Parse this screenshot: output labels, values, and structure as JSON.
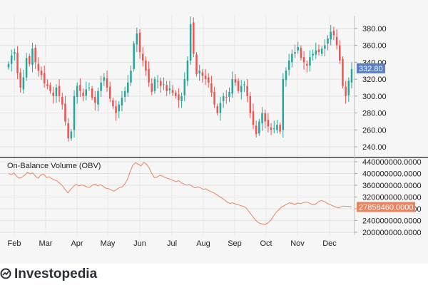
{
  "chart_data": [
    {
      "type": "candlestick",
      "title": "",
      "ylim": [
        230,
        395
      ],
      "y_ticks": [
        "380.00",
        "360.00",
        "340.00",
        "320.00",
        "300.00",
        "280.00",
        "260.00",
        "240.00"
      ],
      "current_value_label": "332.80",
      "colors": {
        "up": "#26a69a",
        "down": "#ef5350",
        "badge": "#5b7fc7"
      },
      "x_months": [
        "Feb",
        "Mar",
        "Apr",
        "May",
        "Jun",
        "Jul",
        "Aug",
        "Sep",
        "Oct",
        "Nov",
        "Dec"
      ],
      "close_path": [
        338,
        348,
        352,
        327,
        310,
        322,
        345,
        338,
        356,
        340,
        330,
        325,
        315,
        312,
        306,
        300,
        310,
        300,
        290,
        270,
        250,
        258,
        300,
        312,
        306,
        300,
        308,
        310,
        298,
        292,
        306,
        316,
        322,
        310,
        297,
        288,
        280,
        290,
        298,
        306,
        316,
        330,
        362,
        374,
        352,
        342,
        330,
        316,
        305,
        320,
        318,
        312,
        314,
        306,
        309,
        304,
        300,
        295,
        300,
        320,
        342,
        385,
        350,
        326,
        330,
        324,
        320,
        316,
        304,
        290,
        280,
        292,
        300,
        298,
        305,
        320,
        316,
        306,
        312,
        314,
        300,
        280,
        266,
        255,
        270,
        280,
        270,
        264,
        260,
        262,
        266,
        258,
        320,
        330,
        342,
        350,
        352,
        358,
        345,
        340,
        336,
        346,
        350,
        354,
        352,
        356,
        360,
        368,
        376,
        372,
        360,
        342,
        312,
        300,
        318,
        332
      ]
    },
    {
      "type": "line",
      "title": "On-Balance Volume (OBV)",
      "ylim": [
        190000000,
        445000000
      ],
      "y_ticks": [
        "440000000.0000",
        "400000000.0000",
        "360000000.0000",
        "320000000.0000",
        "280000000.0000",
        "240000000.0000",
        "200000000.0000"
      ],
      "current_value_label": "27858460.0000",
      "line_color": "#e8845f",
      "values": [
        400,
        396,
        402,
        390,
        384,
        388,
        394,
        404,
        399,
        402,
        390,
        384,
        396,
        398,
        387,
        389,
        383,
        378,
        374,
        366,
        358,
        345,
        334,
        346,
        356,
        363,
        358,
        361,
        359,
        354,
        353,
        360,
        364,
        358,
        362,
        356,
        350,
        348,
        344,
        340,
        346,
        352,
        354,
        364,
        380,
        406,
        428,
        437,
        432,
        426,
        438,
        432,
        420,
        400,
        386,
        388,
        394,
        391,
        386,
        383,
        380,
        376,
        372,
        376,
        368,
        364,
        360,
        362,
        356,
        351,
        354,
        352,
        346,
        348,
        342,
        338,
        334,
        328,
        322,
        316,
        310,
        302,
        298,
        300,
        296,
        294,
        290,
        288,
        282,
        270,
        258,
        246,
        236,
        230,
        228,
        226,
        232,
        240,
        254,
        268,
        276,
        286,
        290,
        296,
        300,
        298,
        294,
        300,
        297,
        300,
        303,
        301,
        296,
        293,
        298,
        306,
        308,
        304,
        298,
        294,
        290,
        286,
        283,
        286,
        289,
        288,
        288,
        286
      ]
    }
  ],
  "brand": {
    "name": "Investopedia"
  }
}
